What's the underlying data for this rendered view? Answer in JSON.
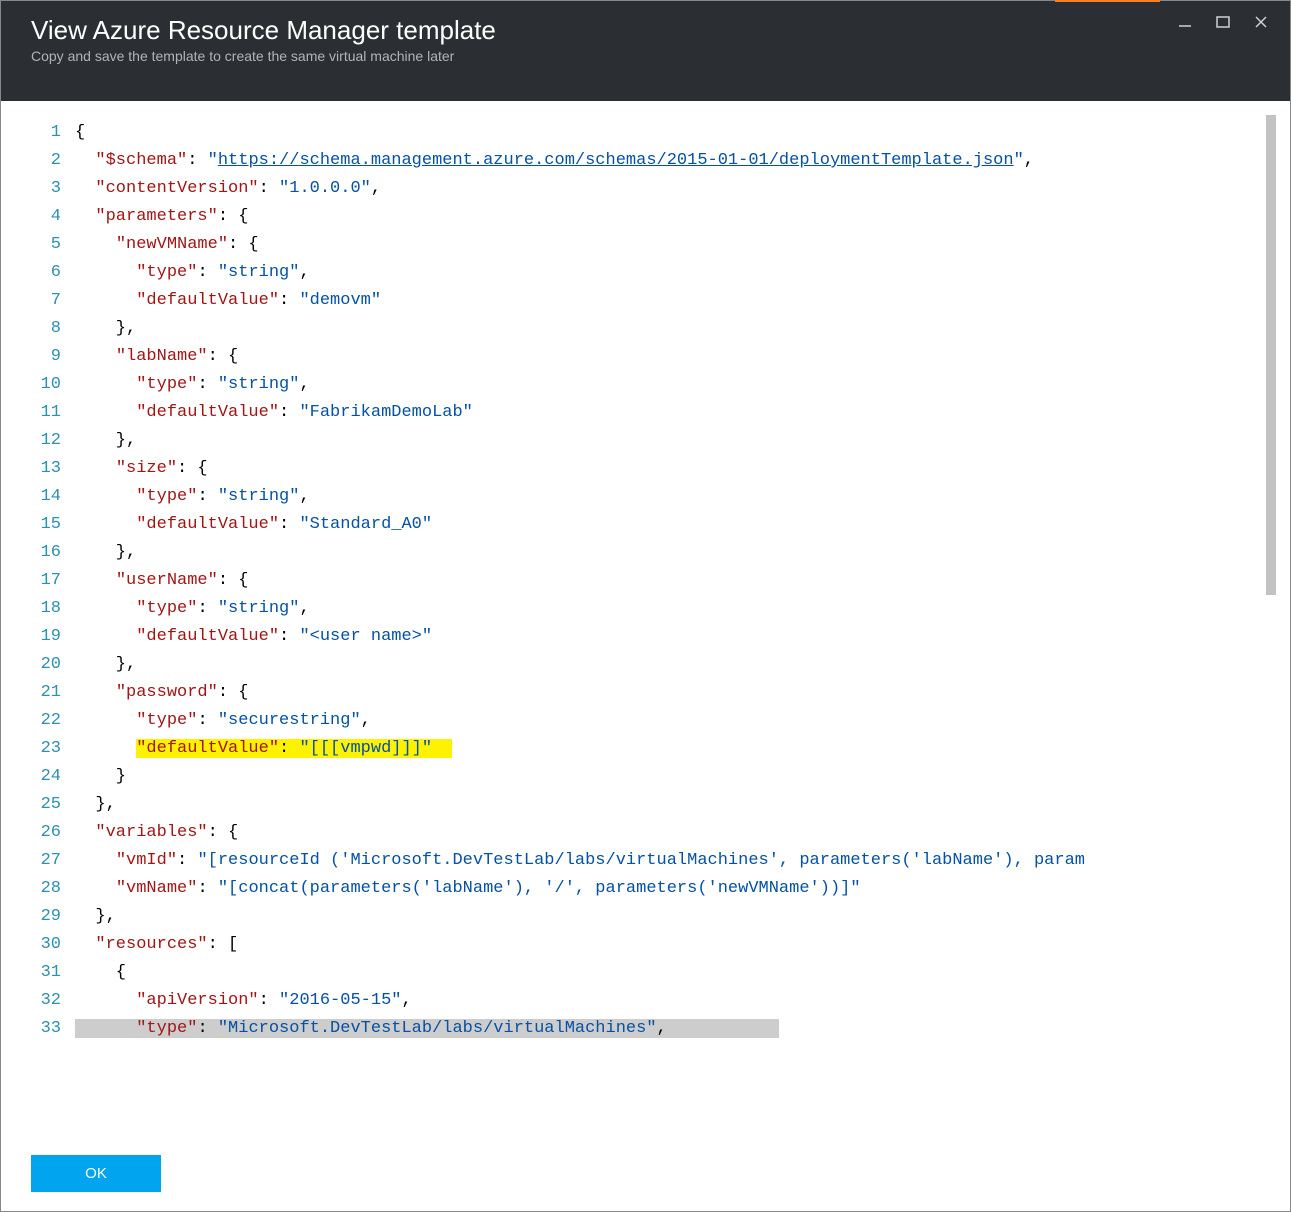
{
  "header": {
    "title": "View Azure Resource Manager template",
    "subtitle": "Copy and save the template to create the same virtual machine later"
  },
  "footer": {
    "ok_label": "OK"
  },
  "code": {
    "first_line_number": 1,
    "lines": [
      {
        "n": 1,
        "tokens": [
          {
            "t": "{",
            "c": "punc"
          }
        ]
      },
      {
        "n": 2,
        "tokens": [
          {
            "t": "  ",
            "c": "punc"
          },
          {
            "t": "\"$schema\"",
            "c": "key"
          },
          {
            "t": ": ",
            "c": "punc"
          },
          {
            "t": "\"",
            "c": "str"
          },
          {
            "t": "https://schema.management.azure.com/schemas/2015-01-01/deploymentTemplate.json",
            "c": "link"
          },
          {
            "t": "\"",
            "c": "str"
          },
          {
            "t": ",",
            "c": "punc"
          }
        ]
      },
      {
        "n": 3,
        "tokens": [
          {
            "t": "  ",
            "c": "punc"
          },
          {
            "t": "\"contentVersion\"",
            "c": "key"
          },
          {
            "t": ": ",
            "c": "punc"
          },
          {
            "t": "\"1.0.0.0\"",
            "c": "str"
          },
          {
            "t": ",",
            "c": "punc"
          }
        ]
      },
      {
        "n": 4,
        "tokens": [
          {
            "t": "  ",
            "c": "punc"
          },
          {
            "t": "\"parameters\"",
            "c": "key"
          },
          {
            "t": ": {",
            "c": "punc"
          }
        ]
      },
      {
        "n": 5,
        "tokens": [
          {
            "t": "    ",
            "c": "punc"
          },
          {
            "t": "\"newVMName\"",
            "c": "key"
          },
          {
            "t": ": {",
            "c": "punc"
          }
        ]
      },
      {
        "n": 6,
        "tokens": [
          {
            "t": "      ",
            "c": "punc"
          },
          {
            "t": "\"type\"",
            "c": "key"
          },
          {
            "t": ": ",
            "c": "punc"
          },
          {
            "t": "\"string\"",
            "c": "str"
          },
          {
            "t": ",",
            "c": "punc"
          }
        ]
      },
      {
        "n": 7,
        "tokens": [
          {
            "t": "      ",
            "c": "punc"
          },
          {
            "t": "\"defaultValue\"",
            "c": "key"
          },
          {
            "t": ": ",
            "c": "punc"
          },
          {
            "t": "\"demovm\"",
            "c": "str"
          }
        ]
      },
      {
        "n": 8,
        "tokens": [
          {
            "t": "    },",
            "c": "punc"
          }
        ]
      },
      {
        "n": 9,
        "tokens": [
          {
            "t": "    ",
            "c": "punc"
          },
          {
            "t": "\"labName\"",
            "c": "key"
          },
          {
            "t": ": {",
            "c": "punc"
          }
        ]
      },
      {
        "n": 10,
        "tokens": [
          {
            "t": "      ",
            "c": "punc"
          },
          {
            "t": "\"type\"",
            "c": "key"
          },
          {
            "t": ": ",
            "c": "punc"
          },
          {
            "t": "\"string\"",
            "c": "str"
          },
          {
            "t": ",",
            "c": "punc"
          }
        ]
      },
      {
        "n": 11,
        "tokens": [
          {
            "t": "      ",
            "c": "punc"
          },
          {
            "t": "\"defaultValue\"",
            "c": "key"
          },
          {
            "t": ": ",
            "c": "punc"
          },
          {
            "t": "\"FabrikamDemoLab\"",
            "c": "str"
          }
        ]
      },
      {
        "n": 12,
        "tokens": [
          {
            "t": "    },",
            "c": "punc"
          }
        ]
      },
      {
        "n": 13,
        "tokens": [
          {
            "t": "    ",
            "c": "punc"
          },
          {
            "t": "\"size\"",
            "c": "key"
          },
          {
            "t": ": {",
            "c": "punc"
          }
        ]
      },
      {
        "n": 14,
        "tokens": [
          {
            "t": "      ",
            "c": "punc"
          },
          {
            "t": "\"type\"",
            "c": "key"
          },
          {
            "t": ": ",
            "c": "punc"
          },
          {
            "t": "\"string\"",
            "c": "str"
          },
          {
            "t": ",",
            "c": "punc"
          }
        ]
      },
      {
        "n": 15,
        "tokens": [
          {
            "t": "      ",
            "c": "punc"
          },
          {
            "t": "\"defaultValue\"",
            "c": "key"
          },
          {
            "t": ": ",
            "c": "punc"
          },
          {
            "t": "\"Standard_A0\"",
            "c": "str"
          }
        ]
      },
      {
        "n": 16,
        "tokens": [
          {
            "t": "    },",
            "c": "punc"
          }
        ]
      },
      {
        "n": 17,
        "tokens": [
          {
            "t": "    ",
            "c": "punc"
          },
          {
            "t": "\"userName\"",
            "c": "key"
          },
          {
            "t": ": {",
            "c": "punc"
          }
        ]
      },
      {
        "n": 18,
        "tokens": [
          {
            "t": "      ",
            "c": "punc"
          },
          {
            "t": "\"type\"",
            "c": "key"
          },
          {
            "t": ": ",
            "c": "punc"
          },
          {
            "t": "\"string\"",
            "c": "str"
          },
          {
            "t": ",",
            "c": "punc"
          }
        ]
      },
      {
        "n": 19,
        "tokens": [
          {
            "t": "      ",
            "c": "punc"
          },
          {
            "t": "\"defaultValue\"",
            "c": "key"
          },
          {
            "t": ": ",
            "c": "punc"
          },
          {
            "t": "\"<user name>\"",
            "c": "str"
          }
        ]
      },
      {
        "n": 20,
        "tokens": [
          {
            "t": "    },",
            "c": "punc"
          }
        ]
      },
      {
        "n": 21,
        "tokens": [
          {
            "t": "    ",
            "c": "punc"
          },
          {
            "t": "\"password\"",
            "c": "key"
          },
          {
            "t": ": {",
            "c": "punc"
          }
        ]
      },
      {
        "n": 22,
        "tokens": [
          {
            "t": "      ",
            "c": "punc"
          },
          {
            "t": "\"type\"",
            "c": "key"
          },
          {
            "t": ": ",
            "c": "punc"
          },
          {
            "t": "\"securestring\"",
            "c": "str"
          },
          {
            "t": ",",
            "c": "punc"
          }
        ]
      },
      {
        "n": 23,
        "tokens": [
          {
            "t": "      ",
            "c": "punc"
          },
          {
            "t": "\"defaultValue\"",
            "c": "key",
            "hl": true
          },
          {
            "t": ": ",
            "c": "punc",
            "hl": true
          },
          {
            "t": "\"[[[vmpwd]]]\"",
            "c": "str",
            "hl": true
          },
          {
            "t": "  ",
            "c": "punc",
            "hl": true
          }
        ]
      },
      {
        "n": 24,
        "tokens": [
          {
            "t": "    }",
            "c": "punc"
          }
        ]
      },
      {
        "n": 25,
        "tokens": [
          {
            "t": "  },",
            "c": "punc"
          }
        ]
      },
      {
        "n": 26,
        "tokens": [
          {
            "t": "  ",
            "c": "punc"
          },
          {
            "t": "\"variables\"",
            "c": "key"
          },
          {
            "t": ": {",
            "c": "punc"
          }
        ]
      },
      {
        "n": 27,
        "tokens": [
          {
            "t": "    ",
            "c": "punc"
          },
          {
            "t": "\"vmId\"",
            "c": "key"
          },
          {
            "t": ": ",
            "c": "punc"
          },
          {
            "t": "\"[resourceId ('Microsoft.DevTestLab/labs/virtualMachines', parameters('labName'), param",
            "c": "str"
          }
        ]
      },
      {
        "n": 28,
        "tokens": [
          {
            "t": "    ",
            "c": "punc"
          },
          {
            "t": "\"vmName\"",
            "c": "key"
          },
          {
            "t": ": ",
            "c": "punc"
          },
          {
            "t": "\"[concat(parameters('labName'), '/', parameters('newVMName'))]\"",
            "c": "str"
          }
        ]
      },
      {
        "n": 29,
        "tokens": [
          {
            "t": "  },",
            "c": "punc"
          }
        ]
      },
      {
        "n": 30,
        "tokens": [
          {
            "t": "  ",
            "c": "punc"
          },
          {
            "t": "\"resources\"",
            "c": "key"
          },
          {
            "t": ": [",
            "c": "punc"
          }
        ]
      },
      {
        "n": 31,
        "tokens": [
          {
            "t": "    {",
            "c": "punc"
          }
        ]
      },
      {
        "n": 32,
        "tokens": [
          {
            "t": "      ",
            "c": "punc"
          },
          {
            "t": "\"apiVersion\"",
            "c": "key"
          },
          {
            "t": ": ",
            "c": "punc"
          },
          {
            "t": "\"2016-05-15\"",
            "c": "str"
          },
          {
            "t": ",",
            "c": "punc"
          }
        ]
      },
      {
        "n": 33,
        "tokens": [
          {
            "t": "      ",
            "c": "punc",
            "sel": true
          },
          {
            "t": "\"type\"",
            "c": "key",
            "sel": true
          },
          {
            "t": ": ",
            "c": "punc",
            "sel": true
          },
          {
            "t": "\"Microsoft.DevTestLab/labs/virtualMachines\"",
            "c": "str",
            "sel": true
          },
          {
            "t": ",",
            "c": "punc",
            "sel": true
          },
          {
            "t": "           ",
            "c": "punc",
            "sel": true
          }
        ]
      }
    ]
  }
}
